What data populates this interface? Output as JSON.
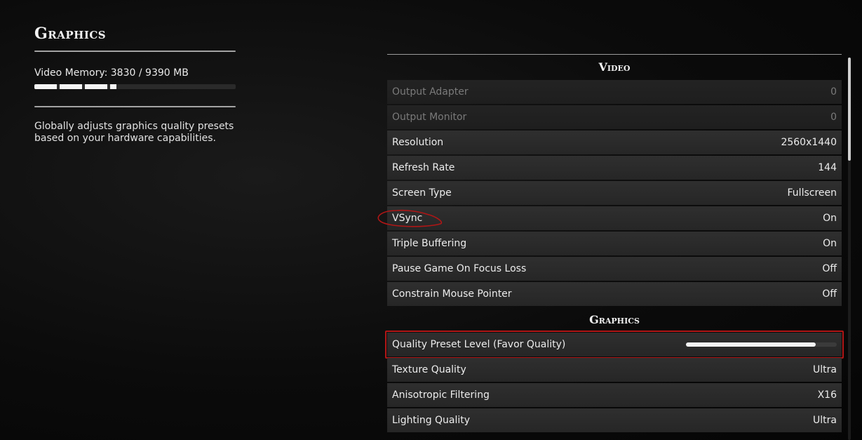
{
  "left_panel": {
    "title": "Graphics",
    "video_memory_label": "Video Memory:",
    "video_memory_used": "3830",
    "video_memory_sep": "/",
    "video_memory_total": "9390",
    "video_memory_unit": "MB",
    "video_memory_fraction": 0.408,
    "description": "Globally adjusts graphics quality presets based on your hardware capabilities."
  },
  "sections": [
    {
      "header": "Video",
      "rows": [
        {
          "label": "Output Adapter",
          "value": "0",
          "disabled": true
        },
        {
          "label": "Output Monitor",
          "value": "0",
          "disabled": true
        },
        {
          "label": "Resolution",
          "value": "2560x1440"
        },
        {
          "label": "Refresh Rate",
          "value": "144"
        },
        {
          "label": "Screen Type",
          "value": "Fullscreen"
        },
        {
          "label": "VSync",
          "value": "On",
          "annotated_circle": true
        },
        {
          "label": "Triple Buffering",
          "value": "On"
        },
        {
          "label": "Pause Game On Focus Loss",
          "value": "Off"
        },
        {
          "label": "Constrain Mouse Pointer",
          "value": "Off"
        }
      ]
    },
    {
      "header": "Graphics",
      "rows": [
        {
          "label": "Quality Preset Level (Favor Quality)",
          "slider_fraction": 0.86,
          "annotated_box": true
        },
        {
          "label": "Texture Quality",
          "value": "Ultra"
        },
        {
          "label": "Anisotropic Filtering",
          "value": "X16"
        },
        {
          "label": "Lighting Quality",
          "value": "Ultra"
        }
      ]
    }
  ],
  "colors": {
    "annotation_red": "#b01616",
    "row_background": "#2a2a2a",
    "text": "#ececec",
    "disabled_text": "#7a7a7a"
  },
  "scrollbar": {
    "thumb_fraction": 0.27
  }
}
